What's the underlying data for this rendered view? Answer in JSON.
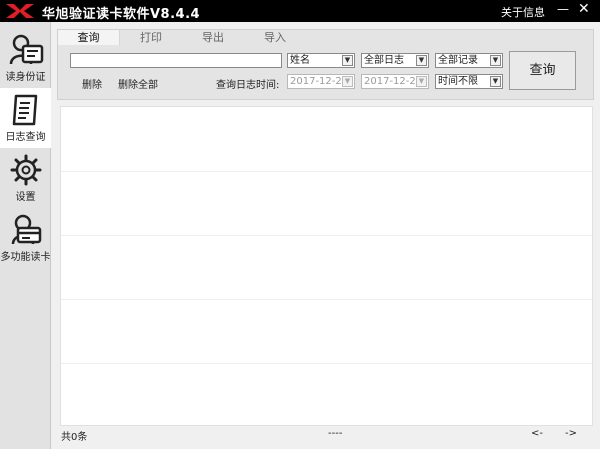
{
  "app": {
    "title": "华旭验证读卡软件V8.4.4",
    "about_label": "关于信息",
    "min_glyph": "—",
    "close_glyph": "✕",
    "logo_icon": "logo-icon"
  },
  "sidebar": {
    "items": [
      {
        "label": "读身份证",
        "icon": "id-card-reader-icon",
        "active": false
      },
      {
        "label": "日志查询",
        "icon": "log-document-icon",
        "active": true
      },
      {
        "label": "设置",
        "icon": "gear-icon",
        "active": false
      },
      {
        "label": "多功能读卡",
        "icon": "card-reader-icon",
        "active": false
      }
    ]
  },
  "tabs": [
    {
      "label": "查询",
      "active": true
    },
    {
      "label": "打印",
      "active": false
    },
    {
      "label": "导出",
      "active": false
    },
    {
      "label": "导入",
      "active": false
    }
  ],
  "filters": {
    "search_value": "",
    "field_select": "姓名",
    "log_type_select": "全部日志",
    "record_select": "全部记录",
    "date_label": "查询日志时间:",
    "date_start": "2017-12-26",
    "date_end": "2017-12-26",
    "time_range_select": "时间不限",
    "dropdown_arrow": "▼"
  },
  "actions": {
    "delete_label": "删除",
    "delete_all_label": "删除全部",
    "query_label": "查询"
  },
  "status": {
    "count_text": "共0条",
    "mid_text": "----",
    "prev_text": "<-",
    "next_text": "->"
  },
  "colors": {
    "titlebar": "#000000",
    "logo_red": "#e21e25",
    "sidebar": "#e2e2e2",
    "active_item": "#ffffff"
  }
}
